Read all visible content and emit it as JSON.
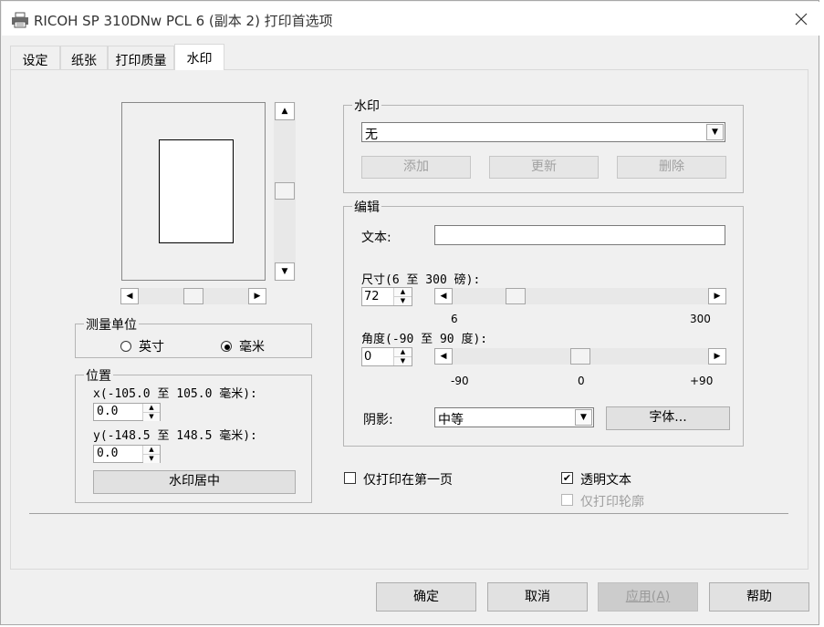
{
  "window": {
    "title": "RICOH SP 310DNw PCL 6 (副本 2) 打印首选项"
  },
  "tabs": [
    {
      "label": "设定"
    },
    {
      "label": "纸张"
    },
    {
      "label": "打印质量"
    },
    {
      "label": "水印"
    }
  ],
  "active_tab": "水印",
  "units": {
    "legend": "测量单位",
    "inch": "英寸",
    "mm": "毫米",
    "selected": "毫米"
  },
  "position": {
    "legend": "位置",
    "x_label": "x(-105.0 至 105.0 毫米):",
    "x_value": "0.0",
    "y_label": "y(-148.5 至 148.5 毫米):",
    "y_value": "0.0",
    "center_button": "水印居中"
  },
  "watermark": {
    "legend": "水印",
    "selected": "无",
    "add": "添加",
    "update": "更新",
    "delete": "删除"
  },
  "edit": {
    "legend": "编辑",
    "text_label": "文本:",
    "text_value": "",
    "size_label": "尺寸(6 至 300 磅):",
    "size_value": "72",
    "size_min": "6",
    "size_max": "300",
    "angle_label": "角度(-90 至 90 度):",
    "angle_value": "0",
    "angle_min": "-90",
    "angle_mid": "0",
    "angle_max": "+90",
    "shadow_label": "阴影:",
    "shadow_value": "中等",
    "font_button": "字体..."
  },
  "options": {
    "first_page_only": "仅打印在第一页",
    "first_page_checked": false,
    "transparent": "透明文本",
    "transparent_checked": true,
    "outline_only": "仅打印轮廓",
    "outline_checked": false
  },
  "footer": {
    "ok": "确定",
    "cancel": "取消",
    "apply": "应用(A)",
    "help": "帮助"
  }
}
